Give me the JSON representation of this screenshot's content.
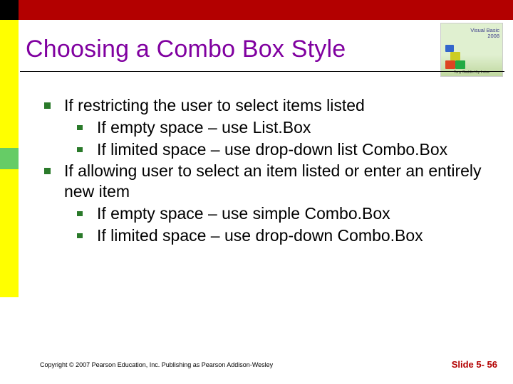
{
  "logo": {
    "line1": "Visual Basic",
    "line2": "2008",
    "subtitle": "Tony Gaddis   Kip Irvine"
  },
  "title": "Choosing a Combo Box Style",
  "bullets": {
    "b1": "If restricting the user to select items listed",
    "b1a": "If empty space – use List.Box",
    "b1b": "If limited space – use drop-down list Combo.Box",
    "b2": "If allowing user to select an item listed or enter an entirely new item",
    "b2a": "If empty space – use simple Combo.Box",
    "b2b": "If limited space – use drop-down Combo.Box"
  },
  "footer": {
    "copyright": "Copyright © 2007 Pearson Education, Inc. Publishing as Pearson Addison-Wesley",
    "slide": "Slide 5- 56"
  }
}
